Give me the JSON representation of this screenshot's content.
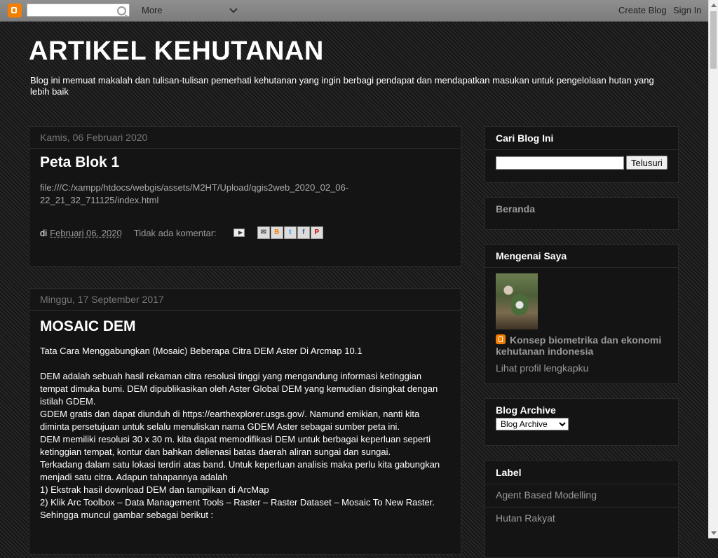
{
  "navbar": {
    "more_label": "More",
    "create_blog": "Create Blog",
    "sign_in": "Sign In"
  },
  "header": {
    "title": "ARTIKEL KEHUTANAN",
    "description": "Blog ini memuat makalah dan tulisan-tulisan pemerhati kehutanan yang ingin berbagi pendapat dan mendapatkan masukan untuk pengelolaan hutan yang lebih baik"
  },
  "posts": [
    {
      "date": "Kamis, 06 Februari 2020",
      "title": "Peta Blok 1",
      "body": "file:///C:/xampp/htdocs/webgis/assets/M2HT/Upload/qgis2web_2020_02_06-22_21_32_711125/index.html",
      "footer_by": "di",
      "footer_date": "Februari 06, 2020",
      "footer_comments": "Tidak ada komentar:"
    },
    {
      "date": "Minggu, 17 September 2017",
      "title": "MOSAIC DEM",
      "intro": "Tata Cara Menggabungkan (Mosaic) Beberapa Citra DEM Aster Di Arcmap 10.1",
      "p1": "DEM adalah sebuah hasil rekaman citra resolusi tinggi yang mengandung  informasi ketinggian tempat dimuka bumi. DEM dipublikasikan oleh Aster Global DEM yang kemudian disingkat dengan istilah GDEM.",
      "p2": "GDEM gratis dan dapat diunduh di https://earthexplorer.usgs.gov/. Namund emikian, nanti kita diminta persetujuan untuk selalu menuliskan nama GDEM Aster sebagai sumber peta ini.",
      "p3": "DEM memiliki resolusi 30 x 30 m. kita dapat memodifikasi DEM untuk berbagai keperluan seperti ketinggian tempat, kontur dan bahkan delienasi batas daerah aliran sungai dan sungai.",
      "p4": "Terkadang dalam satu lokasi terdiri atas band. Untuk keperluan analisis maka perlu kita gabungkan menjadi satu citra. Adapun tahapannya adalah",
      "p5": "1) Ekstrak hasil download DEM dan tampilkan di ArcMap",
      "p6": "2) Klik Arc Toolbox – Data Management Tools – Raster – Raster Dataset – Mosaic To New Raster. Sehingga muncul gambar sebagai berikut :"
    }
  ],
  "sidebar": {
    "search": {
      "title": "Cari Blog Ini",
      "button": "Telusuri"
    },
    "home": {
      "title": "Beranda"
    },
    "about": {
      "title": "Mengenai Saya",
      "name": "Konsep biometrika dan ekonomi kehutanan indonesia",
      "profile_link": "Lihat profil lengkapku"
    },
    "archive": {
      "title": "Blog Archive",
      "select_value": "Blog Archive"
    },
    "labels": {
      "title": "Label",
      "items": [
        "Agent Based Modelling",
        "Hutan Rakyat"
      ]
    }
  },
  "icons": {
    "share": [
      "email-icon",
      "blogthis-icon",
      "twitter-icon",
      "facebook-icon",
      "pinterest-icon"
    ]
  }
}
